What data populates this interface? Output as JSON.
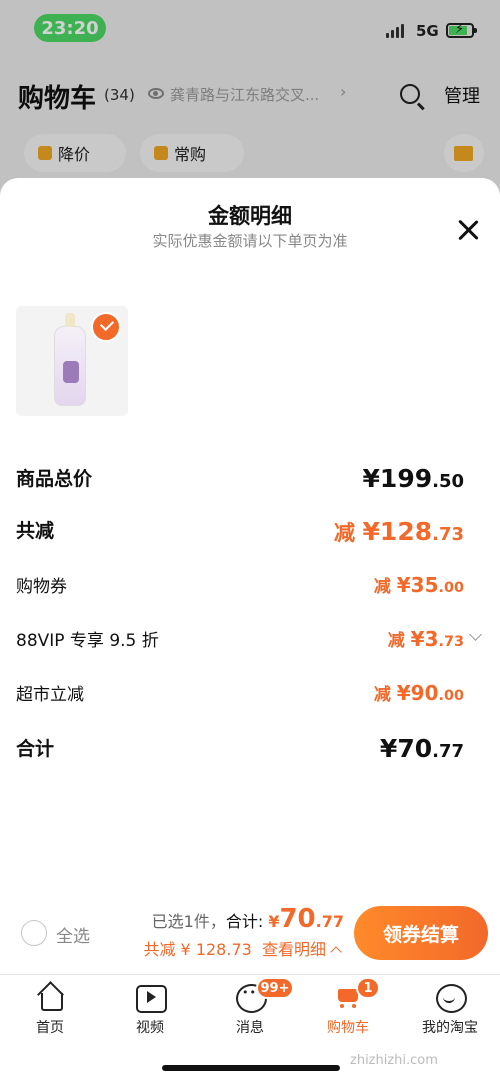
{
  "status_bar": {
    "time": "23:20",
    "network": "5G"
  },
  "cart_header": {
    "title": "购物车",
    "count": "(34)",
    "address": "龚青路与江东路交叉...",
    "manage": "管理"
  },
  "filters": {
    "price_drop": "降价",
    "frequent": "常购"
  },
  "sheet": {
    "title": "金额明细",
    "subtitle": "实际优惠金额请以下单页为准",
    "rows": [
      {
        "label": "商品总价",
        "prefix": "",
        "yen": "¥",
        "int": "199",
        "dec": ".50"
      },
      {
        "label": "共减",
        "prefix": "减 ",
        "yen": "¥",
        "int": "128",
        "dec": ".73"
      },
      {
        "label": "购物券",
        "prefix": "减 ",
        "yen": "¥",
        "int": "35",
        "dec": ".00"
      },
      {
        "label": "88VIP 专享 9.5 折",
        "prefix": "减 ",
        "yen": "¥",
        "int": "3",
        "dec": ".73"
      },
      {
        "label": "超市立减",
        "prefix": "减 ",
        "yen": "¥",
        "int": "90",
        "dec": ".00"
      },
      {
        "label": "合计",
        "prefix": "",
        "yen": "¥",
        "int": "70",
        "dec": ".77"
      }
    ]
  },
  "checkout": {
    "select_all": "全选",
    "selected_text": "已选1件，",
    "total_label": "合计: ",
    "total_yen": "¥",
    "total_int": "70",
    "total_dec": ".77",
    "discount_text": "共减 ¥ 128.73",
    "view_detail": "查看明细",
    "button": "领券结算"
  },
  "tabbar": {
    "home": "首页",
    "video": "视频",
    "messages": "消息",
    "messages_badge": "99+",
    "cart": "购物车",
    "cart_badge": "1",
    "me": "我的淘宝"
  },
  "watermark": "zhizhizhi.com",
  "colors": {
    "accent": "#f2692a",
    "status_green": "#4cd964",
    "chip_icon": "#f0a623"
  }
}
